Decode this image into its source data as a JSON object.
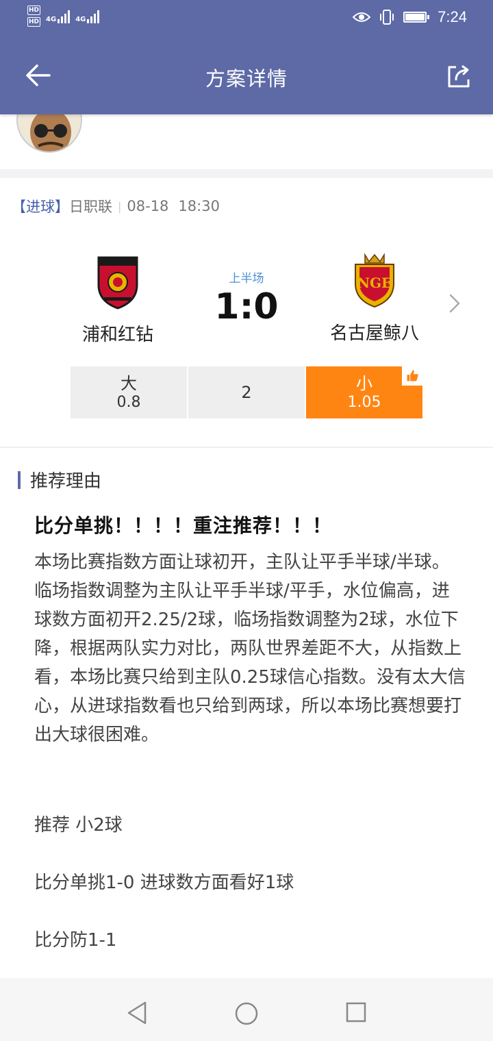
{
  "status_bar": {
    "hd1": "HD",
    "hd2": "HD",
    "net1": "4G",
    "net2": "4G",
    "time": "7:24",
    "icons": [
      "eye-icon",
      "vibrate-icon",
      "battery-icon"
    ]
  },
  "nav": {
    "title": "方案详情",
    "back_icon": "back-arrow-icon",
    "share_icon": "share-icon"
  },
  "match": {
    "tag": "【进球】",
    "league": "日职联",
    "date": "08-18",
    "time": "18:30",
    "home_team": "浦和红钻",
    "away_team": "名古屋鲸八",
    "period": "上半场",
    "score": "1:0"
  },
  "odds": {
    "big_label": "大",
    "big_value": "0.8",
    "line": "2",
    "small_label": "小",
    "small_value": "1.05",
    "selected": "小"
  },
  "reason": {
    "section_title": "推荐理由",
    "headline": "比分单挑！！！！重注推荐！！！",
    "body": "本场比赛指数方面让球初开，主队让平手半球/半球。临场指数调整为主队让平手半球/平手，水位偏高，进球数方面初开2.25/2球，临场指数调整为2球，水位下降，根据两队实力对比，两队世界差距不大，从指数上看，本场比赛只给到主队0.25球信心指数。没有太大信心，从进球指数看也只给到两球，所以本场比赛想要打出大球很困难。",
    "line1": "推荐  小2球",
    "line2": "比分单挑1-0  进球数方面看好1球",
    "line3": "比分防1-1"
  },
  "colors": {
    "header": "#5d6aa6",
    "accent_orange": "#ff8513",
    "tag_blue": "#4561a8",
    "period_blue": "#4a8fd6"
  }
}
